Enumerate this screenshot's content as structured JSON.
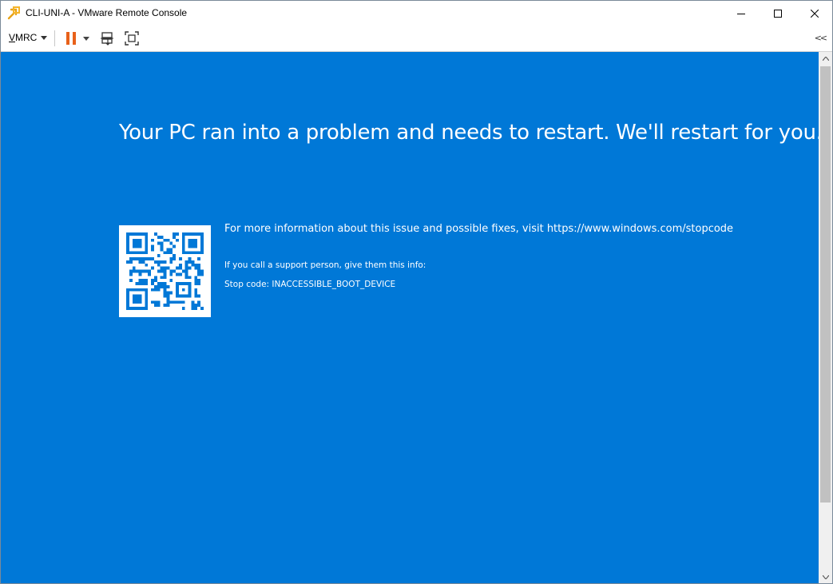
{
  "window": {
    "title": "CLI-UNI-A - VMware Remote Console",
    "app_icon": "vmware-remote-console-icon"
  },
  "window_controls": {
    "minimize_icon": "minimize-icon",
    "maximize_icon": "maximize-icon",
    "close_icon": "close-icon"
  },
  "toolbar": {
    "vmrc_menu_label": "VMRC",
    "vmrc_menu_first_letter": "V",
    "vmrc_menu_rest": "MRC",
    "pause_icon": "pause-icon",
    "send_keys_icon": "send-ctrl-alt-del-icon",
    "fullscreen_icon": "fullscreen-icon",
    "collapse_label": "<<",
    "accent_pause_color": "#e8611a"
  },
  "console": {
    "background_color": "#0078d7",
    "headline": "Your PC ran into a problem and needs to restart. We'll restart for you.",
    "info_line": "For more information about this issue and possible fixes, visit https://www.windows.com/stopcode",
    "support_line": "If you call a support person, give them this info:",
    "stop_code_line": "Stop code: INACCESSIBLE_BOOT_DEVICE"
  }
}
